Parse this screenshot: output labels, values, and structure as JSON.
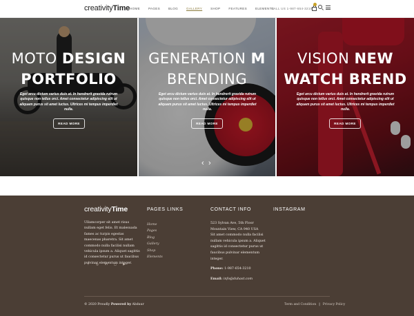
{
  "header": {
    "logo_light": "creativity",
    "logo_bold": "Time",
    "nav": [
      "HOME",
      "PAGES",
      "BLOG",
      "GALLERY",
      "SHOP",
      "FEATURES",
      "ELEMENTS"
    ],
    "active_nav": "GALLERY",
    "call": "CALL US 1-987-654-3210",
    "cart_icon": "shopping-bag-icon",
    "search_icon": "search-icon",
    "menu_icon": "hamburger-menu-icon"
  },
  "slides": [
    {
      "title_light_1": "MOTO ",
      "title_bold_1": "DESIGN",
      "title_light_2": "",
      "title_bold_2": "PORTFOLIO",
      "description": "Eget arcu dictum varius duis at. In hendrerit gravida rutrum quisque non tellus orci. Amet consectetur adipiscing elit ut aliquam purus sit amet luctus. Ultrices mi tempus imperdiet nulla.",
      "button": "READ MORE"
    },
    {
      "title_light_1": "GENERATION ",
      "title_bold_1": "M",
      "title_light_2": "BRENDING",
      "title_bold_2": "",
      "description": "Eget arcu dictum varius duis at. In hendrerit gravida rutrum quisque non tellus orci. Amet consectetur adipiscing elit ut aliquam purus sit amet luctus. Ultrices mi tempus imperdiet nulla.",
      "button": "READ MORE"
    },
    {
      "title_light_1": "VISION ",
      "title_bold_1": "NEW",
      "title_light_2": "",
      "title_bold_2": "WATCH BREND",
      "description": "Eget arcu dictum varius duis at. In hendrerit gravida rutrum quisque non tellus orci. Amet consectetur adipiscing elit ut aliquam purus sit amet luctus. Ultrices mi tempus imperdiet nulla.",
      "button": "READ MORE"
    }
  ],
  "slider_arrows": {
    "prev": "‹",
    "next": "›"
  },
  "footer": {
    "logo_light": "creativity",
    "logo_bold": "Time",
    "about": "Ullamcorper sit amet risus nullam eget felis. Et malesuada fames ac turpis egestas maecenas pharetra. Sit amet commodo nulla facilisi nullam vehicula ipsum a. Aliquet sagittis id consectetur purus ut faucibus pulvinar elementum integer.",
    "socials": [
      "f",
      "◎",
      "in",
      "◻",
      "▶"
    ],
    "pages_heading": "PAGES LINKS",
    "pages": [
      "Home",
      "Pages",
      "Blog",
      "Gallery",
      "Shop",
      "Elements"
    ],
    "contact_heading": "CONTACT INFO",
    "address": "523 Sylvan Ave, 5th Floor Mountain View, CA 940 USA",
    "contact_text": "Sit amet commodo nulla facilisi nullam vehicula ipsum a. Aliquet sagittis id consectetur purus ut faucibus pulvinar elementum integer.",
    "phone_label": "Phone:",
    "phone": "1-987-654-3210",
    "email_label": "Email:",
    "email": "info@duhast.com",
    "instagram_heading": "INSTAGRAM",
    "copyright_prefix": "© 2020 Proudly ",
    "copyright_bold": "Powered by",
    "copyright_brand": " Abduur",
    "terms": "Term and Condition",
    "separator": "|",
    "privacy": "Privacy Policy"
  }
}
